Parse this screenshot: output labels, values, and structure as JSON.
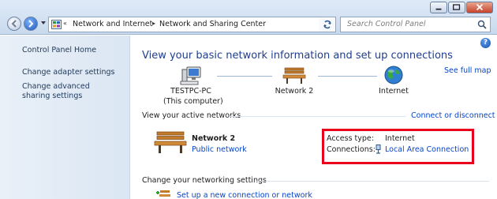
{
  "address_bar": {
    "overflow": "«",
    "crumbs": [
      "Network and Internet",
      "Network and Sharing Center"
    ]
  },
  "search": {
    "placeholder": "Search Control Panel"
  },
  "left_pane": {
    "home": "Control Panel Home",
    "links": [
      "Change adapter settings",
      "Change advanced sharing settings"
    ]
  },
  "main": {
    "heading": "View your basic network information and set up connections",
    "full_map": "See full map",
    "map": {
      "computer": "TESTPC-PC",
      "computer_sub": "(This computer)",
      "network": "Network  2",
      "internet": "Internet"
    },
    "active_networks": {
      "title": "View your active networks",
      "connect_link": "Connect or disconnect",
      "network_name": "Network  2",
      "network_category": "Public network",
      "access_type_label": "Access type:",
      "access_type_value": "Internet",
      "connections_label": "Connections:",
      "connections_value": "Local Area Connection"
    },
    "change_settings": {
      "title": "Change your networking settings",
      "setup": "Set up a new connection or network"
    },
    "help": "?"
  },
  "colors": {
    "link": "#0645c9",
    "heading": "#1f3e8c",
    "highlight_box": "#e8001c"
  }
}
